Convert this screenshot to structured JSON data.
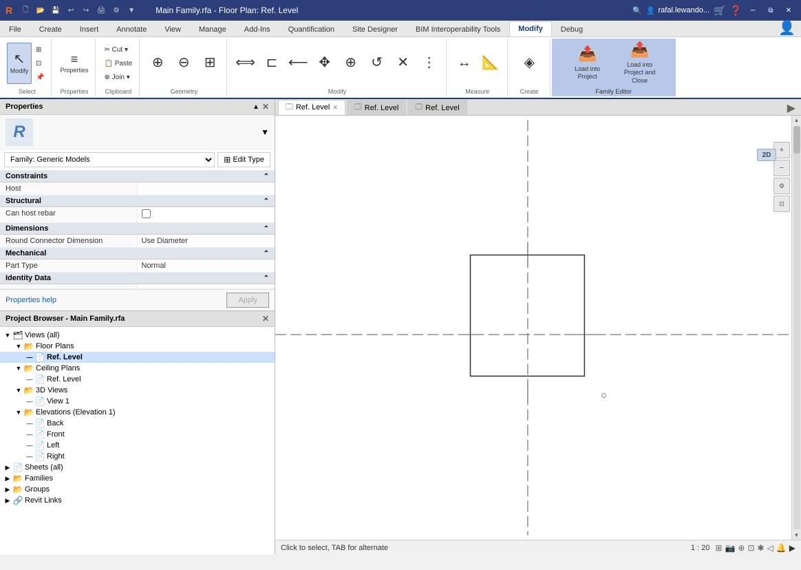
{
  "titlebar": {
    "title": "Main Family.rfa - Floor Plan: Ref. Level",
    "app_icon": "R",
    "win_controls": [
      "minimize",
      "restore",
      "close"
    ]
  },
  "quickaccess": {
    "buttons": [
      "new",
      "open",
      "save",
      "undo",
      "redo",
      "print",
      "annotate",
      "search",
      "settings"
    ]
  },
  "ribbon": {
    "tabs": [
      {
        "id": "file",
        "label": "File",
        "active": false
      },
      {
        "id": "create",
        "label": "Create",
        "active": false
      },
      {
        "id": "insert",
        "label": "Insert",
        "active": false
      },
      {
        "id": "annotate",
        "label": "Annotate",
        "active": false
      },
      {
        "id": "view",
        "label": "View",
        "active": false
      },
      {
        "id": "manage",
        "label": "Manage",
        "active": false
      },
      {
        "id": "addins",
        "label": "Add-Ins",
        "active": false
      },
      {
        "id": "quantification",
        "label": "Quantification",
        "active": false
      },
      {
        "id": "sitedesigner",
        "label": "Site Designer",
        "active": false
      },
      {
        "id": "biminterop",
        "label": "BIM Interoperability Tools",
        "active": false
      },
      {
        "id": "modify",
        "label": "Modify",
        "active": true
      },
      {
        "id": "debug",
        "label": "Debug",
        "active": false
      }
    ],
    "groups": {
      "select": {
        "name": "Select",
        "buttons": [
          {
            "icon": "↖",
            "label": "Modify",
            "active": true
          },
          {
            "icon": "⊞",
            "label": ""
          },
          {
            "icon": "⊡",
            "label": ""
          }
        ]
      },
      "properties": {
        "name": "Properties",
        "buttons": [
          {
            "icon": "≡",
            "label": "Properties"
          }
        ]
      },
      "clipboard": {
        "name": "Clipboard",
        "buttons": [
          {
            "icon": "✂",
            "label": "Cut"
          },
          {
            "icon": "📋",
            "label": "Paste"
          },
          {
            "icon": "⊞",
            "label": "Join"
          }
        ]
      },
      "geometry": {
        "name": "Geometry",
        "buttons": [
          {
            "icon": "⊞",
            "label": ""
          }
        ]
      },
      "modify": {
        "name": "Modify",
        "buttons": [
          {
            "icon": "⊕",
            "label": ""
          },
          {
            "icon": "◯",
            "label": ""
          },
          {
            "icon": "↺",
            "label": ""
          },
          {
            "icon": "✕",
            "label": ""
          }
        ]
      },
      "measure": {
        "name": "Measure",
        "buttons": [
          {
            "icon": "↔",
            "label": ""
          },
          {
            "icon": "📐",
            "label": ""
          }
        ]
      },
      "create": {
        "name": "Create",
        "buttons": [
          {
            "icon": "◈",
            "label": ""
          }
        ]
      },
      "family_editor": {
        "name": "Family Editor",
        "load_into_project": {
          "icon": "📤",
          "label": "Load into\nProject"
        },
        "load_into_project_close": {
          "icon": "📤",
          "label": "Load into\nProject and Close"
        }
      }
    }
  },
  "properties_panel": {
    "title": "Properties",
    "logo_letter": "R",
    "family_label": "Family: Generic Models",
    "edit_type_label": "Edit Type",
    "sections": [
      {
        "name": "Constraints",
        "rows": [
          {
            "label": "Host",
            "value": "",
            "type": "text"
          }
        ]
      },
      {
        "name": "Structural",
        "rows": [
          {
            "label": "Can host rebar",
            "value": "",
            "type": "checkbox",
            "checked": false
          }
        ]
      },
      {
        "name": "Dimensions",
        "rows": [
          {
            "label": "Round Connector Dimension",
            "value": "Use Diameter",
            "type": "text"
          }
        ]
      },
      {
        "name": "Mechanical",
        "rows": [
          {
            "label": "Part Type",
            "value": "Normal",
            "type": "text"
          }
        ]
      },
      {
        "name": "Identity Data",
        "rows": []
      }
    ],
    "help_link": "Properties help",
    "apply_btn": "Apply"
  },
  "project_browser": {
    "title": "Project Browser - Main Family.rfa",
    "tree": [
      {
        "id": "views_all",
        "label": "Views (all)",
        "icon": "📁",
        "level": 0,
        "expanded": true
      },
      {
        "id": "floor_plans",
        "label": "Floor Plans",
        "icon": "📂",
        "level": 1,
        "expanded": true
      },
      {
        "id": "ref_level",
        "label": "Ref. Level",
        "icon": "📄",
        "level": 2,
        "expanded": false,
        "bold": true,
        "selected": true
      },
      {
        "id": "ceiling_plans",
        "label": "Ceiling Plans",
        "icon": "📂",
        "level": 1,
        "expanded": true
      },
      {
        "id": "ceiling_ref_level",
        "label": "Ref. Level",
        "icon": "📄",
        "level": 2,
        "expanded": false
      },
      {
        "id": "3d_views",
        "label": "3D Views",
        "icon": "📂",
        "level": 1,
        "expanded": true
      },
      {
        "id": "view1",
        "label": "View 1",
        "icon": "📄",
        "level": 2,
        "expanded": false
      },
      {
        "id": "elevations",
        "label": "Elevations (Elevation 1)",
        "icon": "📂",
        "level": 1,
        "expanded": true
      },
      {
        "id": "back",
        "label": "Back",
        "icon": "📄",
        "level": 2,
        "expanded": false
      },
      {
        "id": "front",
        "label": "Front",
        "icon": "📄",
        "level": 2,
        "expanded": false
      },
      {
        "id": "left",
        "label": "Left",
        "icon": "📄",
        "level": 2,
        "expanded": false
      },
      {
        "id": "right",
        "label": "Right",
        "icon": "📄",
        "level": 2,
        "expanded": false
      },
      {
        "id": "sheets_all",
        "label": "Sheets (all)",
        "icon": "📄",
        "level": 0,
        "expanded": false
      },
      {
        "id": "families",
        "label": "Families",
        "icon": "📂",
        "level": 0,
        "expanded": false
      },
      {
        "id": "groups",
        "label": "Groups",
        "icon": "📂",
        "level": 0,
        "expanded": false
      },
      {
        "id": "revit_links",
        "label": "Revit Links",
        "icon": "🔗",
        "level": 0,
        "expanded": false
      }
    ]
  },
  "view_tabs": [
    {
      "id": "tab1",
      "label": "Ref. Level",
      "active": true,
      "closable": true
    },
    {
      "id": "tab2",
      "label": "Ref. Level",
      "active": false,
      "closable": false
    },
    {
      "id": "tab3",
      "label": "Ref. Level",
      "active": false,
      "closable": false
    }
  ],
  "canvas": {
    "scale": "1 : 20",
    "badge_2d": "2D"
  },
  "status_bar": {
    "message": "Click to select, TAB for alternate"
  },
  "user": {
    "name": "rafal.lewando...",
    "icon": "👤"
  }
}
